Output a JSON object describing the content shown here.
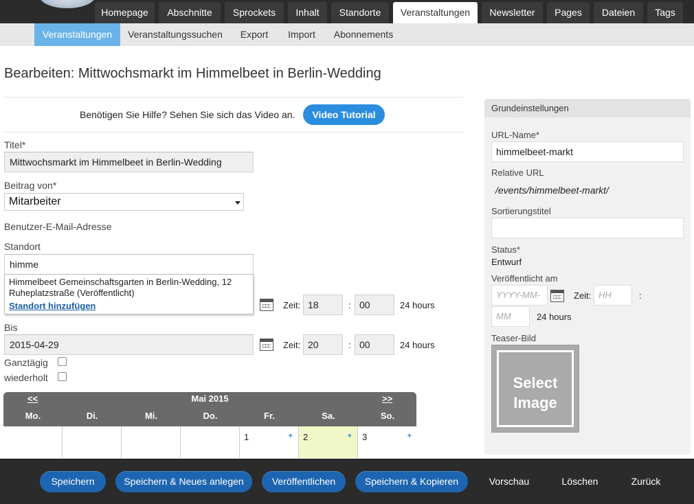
{
  "top_nav": {
    "tabs": [
      {
        "label": "Homepage"
      },
      {
        "label": "Abschnitte"
      },
      {
        "label": "Sprockets"
      },
      {
        "label": "Inhalt"
      },
      {
        "label": "Standorte"
      },
      {
        "label": "Veranstaltungen",
        "active": true
      },
      {
        "label": "Newsletter"
      },
      {
        "label": "Pages"
      },
      {
        "label": "Dateien"
      },
      {
        "label": "Tags"
      }
    ]
  },
  "sub_nav": {
    "tabs": [
      {
        "label": "Veranstaltungen",
        "active": true
      },
      {
        "label": "Veranstaltungssuchen"
      },
      {
        "label": "Export"
      },
      {
        "label": "Import"
      },
      {
        "label": "Abonnements"
      }
    ]
  },
  "page_title": "Bearbeiten: Mittwochsmarkt im Himmelbeet in Berlin-Wedding",
  "help": {
    "text": "Benötigen Sie Hilfe? Sehen Sie sich das Video an.",
    "button": "Video Tutorial"
  },
  "form": {
    "title_label": "Titel*",
    "title_value": "Mittwochsmarkt im Himmelbeet in Berlin-Wedding",
    "author_label": "Beitrag von*",
    "author_value": "Mitarbeiter",
    "email_label": "Benutzer-E-Mail-Adresse",
    "location_label": "Standort",
    "location_value": "himme",
    "autocomplete_item": "Himmelbeet Gemeinschaftsgarten in Berlin-Wedding, 12 Ruheplatzstraße (Veröffentlicht)",
    "autocomplete_add": "Standort hinzufügen",
    "from_time_label": "Zeit:",
    "from_hour": "18",
    "from_minute": "00",
    "time_sep": ":",
    "hours_label": "24 hours",
    "to_label": "Bis",
    "to_date": "2015-04-29",
    "to_hour": "20",
    "to_minute": "00",
    "allday_label": "Ganztägig",
    "repeat_label": "wiederholt"
  },
  "calendar": {
    "prev": "<<",
    "next": ">>",
    "month": "Mai 2015",
    "weekdays": [
      "Mo.",
      "Di.",
      "Mi.",
      "Do.",
      "Fr.",
      "Sa.",
      "So."
    ],
    "days": [
      "",
      "",
      "",
      "",
      "1",
      "2",
      "3"
    ],
    "plus": "+"
  },
  "panel": {
    "heading": "Grundeinstellungen",
    "url_name_label": "URL-Name*",
    "url_name_value": "himmelbeet-markt",
    "relative_url_label": "Relative URL",
    "relative_url_value": "/events/himmelbeet-markt/",
    "sort_title_label": "Sortierungstitel",
    "status_label": "Status*",
    "status_value": "Entwurf",
    "published_label": "Veröffentlicht am",
    "date_placeholder": "YYYY-MM-",
    "time_label": "Zeit:",
    "hour_placeholder": "HH",
    "sep": ":",
    "minute_placeholder": "MM",
    "hours_label": "24 hours",
    "teaser_label": "Teaser-Bild",
    "teaser_button": "Select Image"
  },
  "footer": {
    "save": "Speichern",
    "save_new": "Speichern & Neues anlegen",
    "publish": "Veröffentlichen",
    "save_copy": "Speichern & Kopieren",
    "preview": "Vorschau",
    "delete": "Löschen",
    "back": "Zurück"
  },
  "colors": {
    "accent": "#2b8de0",
    "footer_button": "#1d65b0",
    "nav_bg": "#2b2b2b",
    "subnav_active": "#6ab3e8",
    "today": "#f0f8c7"
  }
}
